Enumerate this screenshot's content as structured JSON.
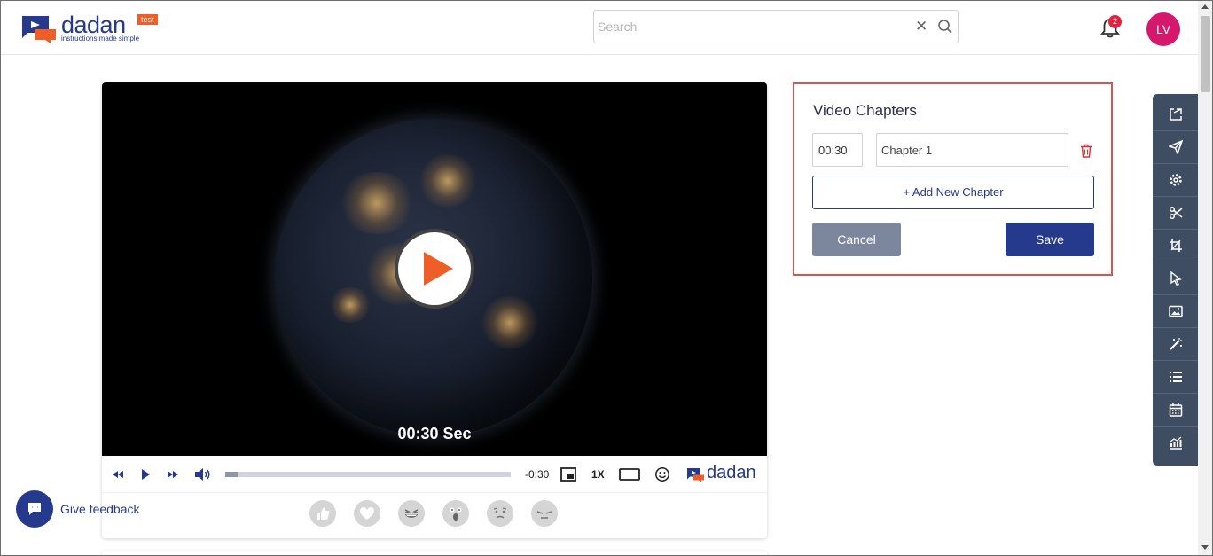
{
  "header": {
    "logo_text": "dadan",
    "logo_tag": "test",
    "logo_subtitle": "instructions made simple",
    "search_placeholder": "Search",
    "search_value": "",
    "notification_count": "2",
    "avatar_initials": "LV"
  },
  "video": {
    "time_overlay": "00:30 Sec",
    "remaining": "-0:30",
    "speed": "1X",
    "progress_fraction": 0.045,
    "brand": "dadan"
  },
  "chapters": {
    "title": "Video Chapters",
    "items": [
      {
        "time": "00:30",
        "name": "Chapter 1"
      }
    ],
    "add_label": "+ Add New Chapter",
    "cancel_label": "Cancel",
    "save_label": "Save"
  },
  "feedback": {
    "label": "Give feedback"
  },
  "icons": {
    "toolbar": [
      "external-link-icon",
      "send-icon",
      "settings-icon",
      "scissors-icon",
      "crop-icon",
      "cursor-icon",
      "image-icon",
      "magic-wand-icon",
      "list-icon",
      "calendar-icon",
      "analytics-icon"
    ],
    "reactions": [
      "thumbs-up-icon",
      "heart-icon",
      "laughing-icon",
      "surprised-icon",
      "sad-icon",
      "angry-icon"
    ]
  },
  "colors": {
    "brand": "#253a8c",
    "accent": "#ef5e27",
    "highlight_border": "#d9534f",
    "toolbar": "#3f4d63",
    "avatar": "#d6186d"
  }
}
